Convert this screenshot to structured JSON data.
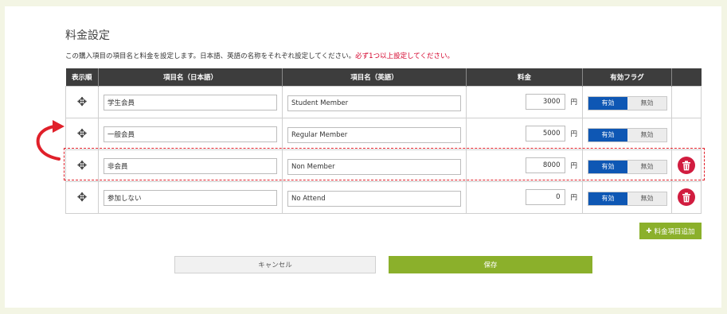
{
  "section": {
    "title": "料金設定",
    "description": "この購入項目の項目名と料金を設定します。日本語、英語の名称をそれぞれ設定してください。",
    "required_note": "必ず1つ以上設定してください。"
  },
  "table": {
    "headers": {
      "order": "表示順",
      "name_ja": "項目名（日本語）",
      "name_en": "項目名（英語）",
      "fee": "料金",
      "flag": "有効フラグ"
    },
    "rows": [
      {
        "name_ja": "学生会員",
        "name_en": "Student Member",
        "fee": "3000",
        "unit": "円",
        "on_label": "有効",
        "off_label": "無効",
        "status": "on",
        "deletable": false
      },
      {
        "name_ja": "一般会員",
        "name_en": "Regular Member",
        "fee": "5000",
        "unit": "円",
        "on_label": "有効",
        "off_label": "無効",
        "status": "on",
        "deletable": false
      },
      {
        "name_ja": "非会員",
        "name_en": "Non Member",
        "fee": "8000",
        "unit": "円",
        "on_label": "有効",
        "off_label": "無効",
        "status": "on",
        "deletable": true
      },
      {
        "name_ja": "参加しない",
        "name_en": "No Attend",
        "fee": "0",
        "unit": "円",
        "on_label": "有効",
        "off_label": "無効",
        "status": "on",
        "deletable": true
      }
    ]
  },
  "buttons": {
    "add": "料金項目追加",
    "cancel": "キャンセル",
    "save": "保存"
  },
  "icons": {
    "drag": "move-handle-icon",
    "delete": "trash-icon",
    "add": "plus-icon",
    "arrow": "curved-arrow-icon"
  },
  "colors": {
    "accent_green": "#8bb02b",
    "toggle_blue": "#0e57b4",
    "delete_red": "#d11c3f",
    "header_dark": "#3d3d3d",
    "highlight_red": "#e0202a"
  }
}
